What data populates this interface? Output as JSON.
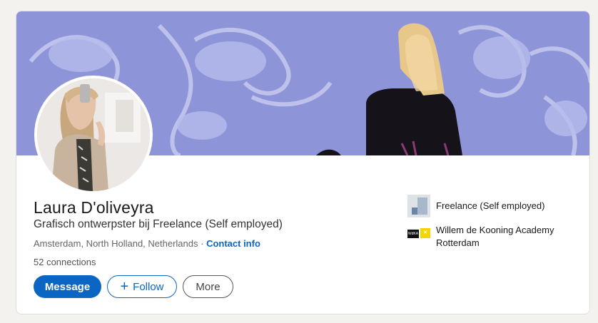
{
  "profile": {
    "name": "Laura D'oliveyra",
    "headline": "Grafisch ontwerpster bij Freelance (Self employed)",
    "location": "Amsterdam, North Holland, Netherlands",
    "separator": " · ",
    "contact_info": "Contact info",
    "connections": "52 connections"
  },
  "actions": {
    "message": "Message",
    "follow_plus": "+",
    "follow": "Follow",
    "more": "More"
  },
  "experience": [
    {
      "company": "Freelance (Self employed)",
      "icon": "company-logo"
    },
    {
      "company": "Willem de Kooning Academy Rotterdam",
      "icon": "school-logo",
      "logo_text": "WdKA"
    }
  ],
  "colors": {
    "brand_blue": "#0a66c2",
    "banner_bg": "#8d94d8",
    "text_dark": "#191919",
    "text_muted": "#666666"
  }
}
